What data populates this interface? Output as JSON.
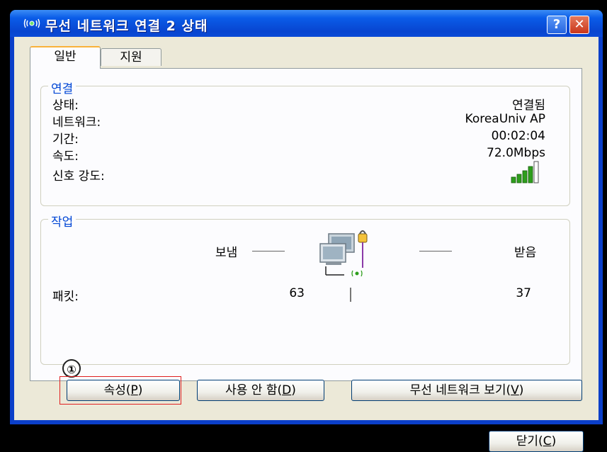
{
  "window": {
    "title": "무선 네트워크 연결 2 상태",
    "help_label": "?",
    "close_label": "✕"
  },
  "tabs": [
    {
      "label": "일반",
      "selected": true
    },
    {
      "label": "지원",
      "selected": false
    }
  ],
  "connection": {
    "group_label": "연결",
    "rows": [
      {
        "label": "상태:",
        "value": "연결됨"
      },
      {
        "label": "네트워크:",
        "value": "KoreaUniv AP"
      },
      {
        "label": "기간:",
        "value": "00:02:04"
      },
      {
        "label": "속도:",
        "value": "72.0Mbps"
      },
      {
        "label": "신호 강도:",
        "value": ""
      }
    ],
    "signal_strength_bars": 4,
    "signal_strength_max": 5
  },
  "activity": {
    "group_label": "작업",
    "sent_label": "보냄",
    "received_label": "받음",
    "packets_label": "패킷:",
    "packets_sent": "63",
    "packets_received": "37"
  },
  "buttons": {
    "properties": {
      "text": "속성(",
      "mnemonic": "P",
      "suffix": ")"
    },
    "disable": {
      "text": "사용 안 함(",
      "mnemonic": "D",
      "suffix": ")"
    },
    "view_networks": {
      "text": "무선 네트워크 보기(",
      "mnemonic": "V",
      "suffix": ")"
    },
    "close": {
      "text": "닫기(",
      "mnemonic": "C",
      "suffix": ")"
    }
  },
  "annotation": {
    "marker": "①"
  },
  "colors": {
    "titlebar": "#0a5ce8",
    "dialog_bg": "#ece9d8",
    "group_label": "#0046d5",
    "annotation_outline": "#e02020",
    "signal_green": "#2e9e1c"
  },
  "icons": {
    "title": "wireless-network-icon",
    "activity": "network-computers-lock-icon",
    "signal": "signal-strength-icon"
  }
}
